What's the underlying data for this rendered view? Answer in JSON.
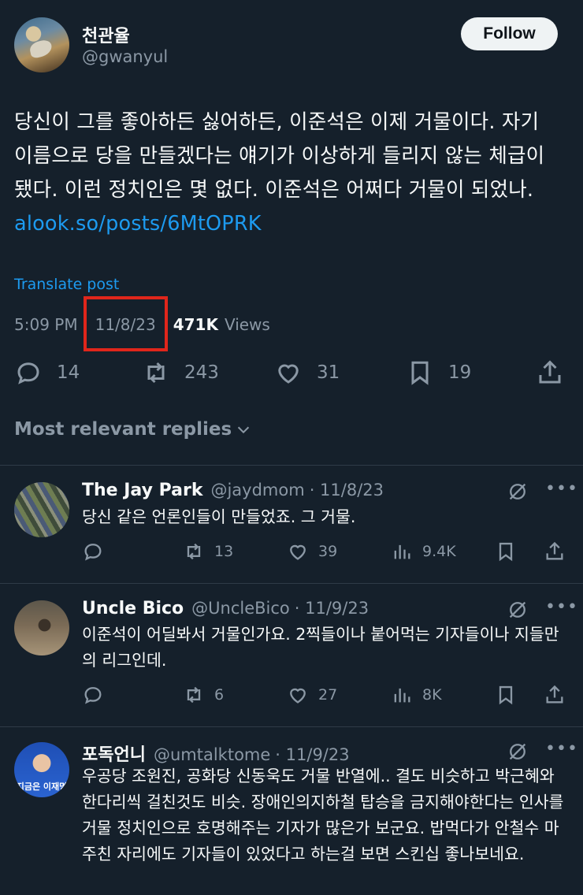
{
  "post": {
    "author_name": "천관율",
    "author_handle": "@gwanyul",
    "follow_label": "Follow",
    "text_lines": [
      "당신이 그를 좋아하든 싫어하든, 이준석은 이제 거물이다. 자기",
      "이름으로 당을 만들겠다는 얘기가 이상하게 들리지 않는 체급이",
      "됐다. 이런 정치인은 몇 없다. 이준석은 어쩌다 거물이 되었나."
    ],
    "link": "alook.so/posts/6MtOPRK",
    "translate_label": "Translate post",
    "time": "5:09 PM",
    "date": "11/8/23",
    "views_count": "471K",
    "views_label": "Views",
    "replies": "14",
    "reposts": "243",
    "likes": "31",
    "bookmarks": "19"
  },
  "replies_filter": "Most relevant replies",
  "replies": [
    {
      "name": "The Jay Park",
      "handle": "@jaydmom",
      "date": "· 11/8/23",
      "text": "당신 같은 언론인들이 만들었죠. 그 거물.",
      "replies": "",
      "reposts": "13",
      "likes": "39",
      "views": "9.4K"
    },
    {
      "name": "Uncle Bico",
      "handle": "@UncleBico",
      "date": "· 11/9/23",
      "text": "이준석이 어딜봐서 거물인가요. 2찍들이나 붙어먹는 기자들이나 지들만의 리그인데.",
      "replies": "",
      "reposts": "6",
      "likes": "27",
      "views": "8K"
    },
    {
      "name": "포독언니",
      "handle": "@umtalktome",
      "date": "· 11/9/23",
      "text": "우공당 조원진, 공화당 신동욱도 거물 반열에.. 결도 비슷하고 박근혜와 한다리씩 걸친것도 비슷. 장애인의지하철 탑승을 금지해야한다는 인사를 거물 정치인으로 호명해주는 기자가 많은가 보군요. 밥먹다가 안철수 마주친 자리에도 기자들이 있었다고 하는걸 보면 스킨십 좋나보네요.",
      "avatar_text": "지금은 이재명"
    }
  ]
}
